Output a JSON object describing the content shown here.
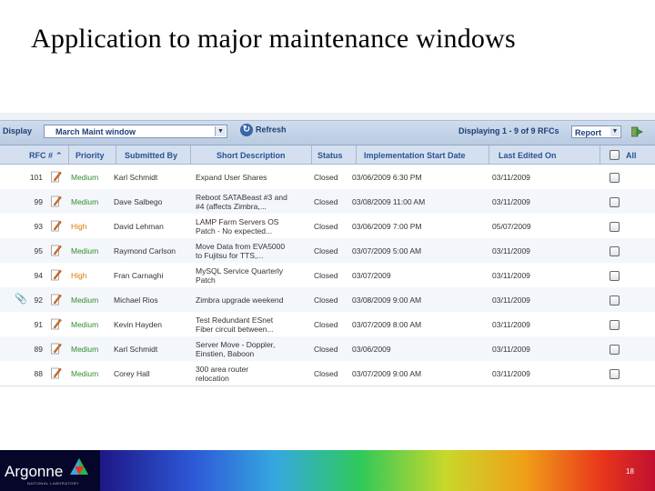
{
  "slide": {
    "title": "Application to major maintenance windows",
    "page_number": "18"
  },
  "toolbar": {
    "display_label": "Display",
    "view_selected": "March Maint window",
    "refresh_label": "Refresh",
    "count_label": "Displaying 1 - 9 of 9 RFCs",
    "report_selected": "Report"
  },
  "columns": {
    "rfc": "RFC #",
    "priority": "Priority",
    "submitted_by": "Submitted By",
    "short_description": "Short Description",
    "status": "Status",
    "impl_start": "Implementation Start Date",
    "last_edited": "Last Edited On",
    "all": "All"
  },
  "rows": [
    {
      "rfc": "101",
      "priority": "Medium",
      "submitted_by": "Karl Schmidt",
      "desc1": "Expand User Shares",
      "desc2": "",
      "status": "Closed",
      "start": "03/06/2009 6:30 PM",
      "edited": "03/11/2009"
    },
    {
      "rfc": "99",
      "priority": "Medium",
      "submitted_by": "Dave Salbego",
      "desc1": "Reboot SATABeast #3 and",
      "desc2": "#4 (affects Zimbra,...",
      "status": "Closed",
      "start": "03/08/2009 11:00 AM",
      "edited": "03/11/2009"
    },
    {
      "rfc": "93",
      "priority": "High",
      "submitted_by": "David Lehman",
      "desc1": "LAMP Farm Servers OS",
      "desc2": "Patch - No expected...",
      "status": "Closed",
      "start": "03/06/2009 7:00 PM",
      "edited": "05/07/2009"
    },
    {
      "rfc": "95",
      "priority": "Medium",
      "submitted_by": "Raymond Carlson",
      "desc1": "Move Data from EVA5000",
      "desc2": "to Fujitsu for TTS,...",
      "status": "Closed",
      "start": "03/07/2009 5:00 AM",
      "edited": "03/11/2009"
    },
    {
      "rfc": "94",
      "priority": "High",
      "submitted_by": "Fran Carnaghi",
      "desc1": "MySQL Service Quarterly",
      "desc2": "Patch",
      "status": "Closed",
      "start": "03/07/2009",
      "edited": "03/11/2009"
    },
    {
      "rfc": "92",
      "priority": "Medium",
      "submitted_by": "Michael Rios",
      "desc1": "Zimbra upgrade weekend",
      "desc2": "",
      "status": "Closed",
      "start": "03/08/2009 9:00 AM",
      "edited": "03/11/2009"
    },
    {
      "rfc": "91",
      "priority": "Medium",
      "submitted_by": "Kevin Hayden",
      "desc1": "Test Redundant ESnet",
      "desc2": "Fiber circuit between...",
      "status": "Closed",
      "start": "03/07/2009 8:00 AM",
      "edited": "03/11/2009"
    },
    {
      "rfc": "89",
      "priority": "Medium",
      "submitted_by": "Karl Schmidt",
      "desc1": "Server Move - Doppler,",
      "desc2": "Einstien, Baboon",
      "status": "Closed",
      "start": "03/06/2009",
      "edited": "03/11/2009"
    },
    {
      "rfc": "88",
      "priority": "Medium",
      "submitted_by": "Corey Hall",
      "desc1": "300 area router",
      "desc2": "relocation",
      "status": "Closed",
      "start": "03/07/2009 9:00 AM",
      "edited": "03/11/2009"
    }
  ],
  "footer": {
    "logo_text": "Argonne",
    "logo_sub": "NATIONAL LABORATORY"
  },
  "colors": {
    "medium": "#2f8f2f",
    "high": "#d97a00",
    "header_text": "#2a5195"
  }
}
